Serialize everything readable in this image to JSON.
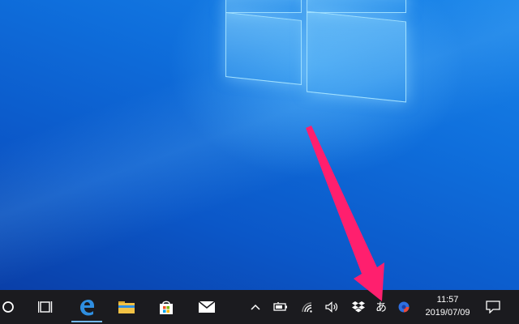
{
  "taskbar": {
    "items": [
      {
        "name": "cortana",
        "icon": "circle-icon"
      },
      {
        "name": "task-view",
        "icon": "task-view-icon"
      },
      {
        "name": "edge",
        "icon": "edge-icon"
      },
      {
        "name": "file-explorer",
        "icon": "folder-icon"
      },
      {
        "name": "store",
        "icon": "store-bag-icon"
      },
      {
        "name": "mail",
        "icon": "mail-icon"
      }
    ],
    "tray": {
      "show_hidden_icon": "chevron-up-icon",
      "battery_icon": "battery-icon",
      "wifi_icon": "wifi-icon",
      "volume_icon": "speaker-icon",
      "dropbox_icon": "dropbox-icon",
      "ime_label": "あ",
      "app_icon": "colored-circle-icon"
    },
    "clock": {
      "time": "11:57",
      "date": "2019/07/09"
    },
    "notifications_icon": "action-center-icon"
  },
  "annotation": {
    "color": "#ff1f6e",
    "points_to": "ime-indicator"
  },
  "colors": {
    "taskbar_bg": "#1b1b1f",
    "wallpaper": "#0b57c8",
    "edge_blue": "#2f8ee0",
    "active_underline": "#76b9ed"
  }
}
